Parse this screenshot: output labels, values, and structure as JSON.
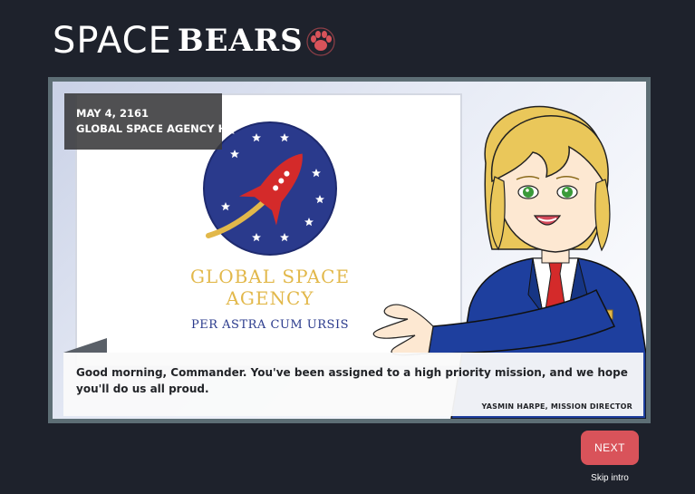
{
  "logo": {
    "word1": "SPACE",
    "word2": "BEARS"
  },
  "location": {
    "date": "MAY 4, 2161",
    "place": "GLOBAL SPACE AGENCY HQ"
  },
  "agency_sign": {
    "name_line1": "GLOBAL SPACE",
    "name_line2": "AGENCY",
    "motto": "PER ASTRA CUM URSIS"
  },
  "dialogue": {
    "text": "Good morning, Commander. You've been assigned to a high priority mission, and we hope you'll do us all proud.",
    "speaker": "YASMIN HARPE, MISSION DIRECTOR"
  },
  "controls": {
    "next_label": "NEXT",
    "skip_label": "Skip intro"
  },
  "colors": {
    "background": "#1e222c",
    "accent": "#d9535a",
    "frame": "#5d6e75",
    "agency_gold": "#e2b84a",
    "agency_navy": "#2a3a8c"
  }
}
